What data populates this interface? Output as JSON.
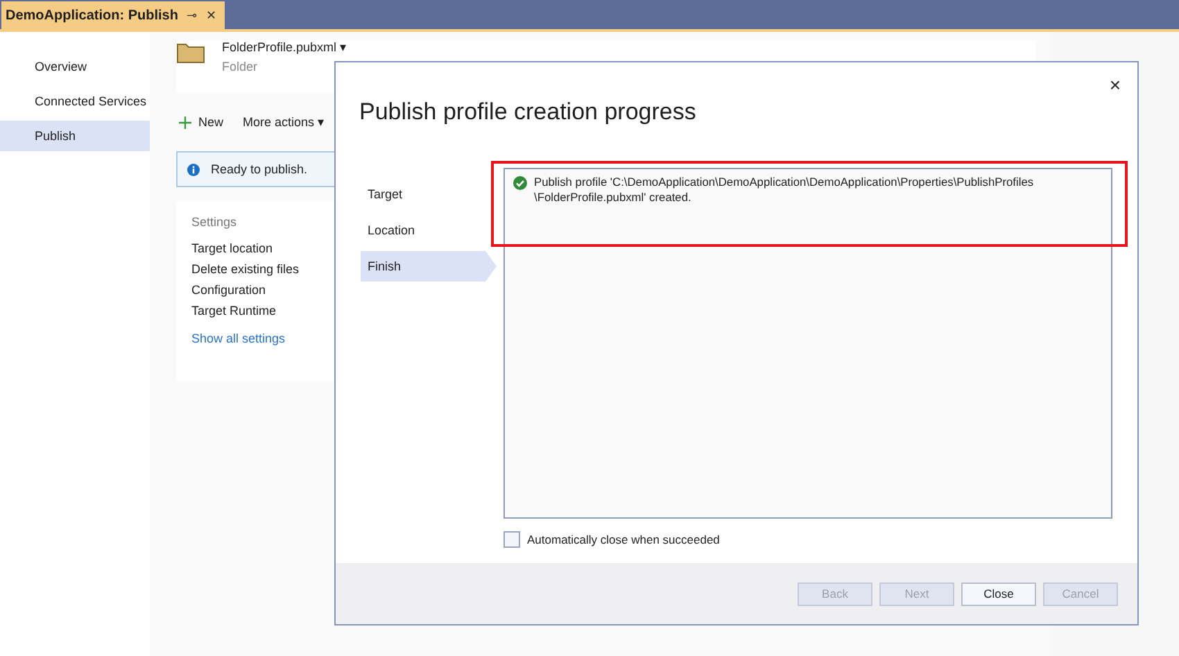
{
  "document_tab": {
    "title": "DemoApplication: Publish",
    "pin": "⊸",
    "close": "✕"
  },
  "nav": [
    {
      "label": "Overview",
      "selected": false
    },
    {
      "label": "Connected Services",
      "selected": false
    },
    {
      "label": "Publish",
      "selected": true
    }
  ],
  "profile": {
    "name": "FolderProfile.pubxml",
    "caret": "▾",
    "type": "Folder"
  },
  "toolbar": {
    "new": "New",
    "more": "More actions",
    "caret": "▾"
  },
  "info": "Ready to publish.",
  "settings": {
    "heading": "Settings",
    "items": [
      "Target location",
      "Delete existing files",
      "Configuration",
      "Target Runtime"
    ],
    "link": "Show all settings"
  },
  "dialog": {
    "title": "Publish profile creation progress",
    "close": "×",
    "steps": [
      {
        "label": "Target",
        "selected": false
      },
      {
        "label": "Location",
        "selected": false
      },
      {
        "label": "Finish",
        "selected": true
      }
    ],
    "log": [
      "Publish profile 'C:\\DemoApplication\\DemoApplication\\DemoApplication\\Properties\\PublishProfiles\n\\FolderProfile.pubxml' created."
    ],
    "auto_close": {
      "label": "Automatically close when succeeded",
      "checked": false
    },
    "buttons": [
      {
        "label": "Back",
        "disabled": true
      },
      {
        "label": "Next",
        "disabled": true
      },
      {
        "label": "Close",
        "disabled": false
      },
      {
        "label": "Cancel",
        "disabled": true
      }
    ]
  }
}
